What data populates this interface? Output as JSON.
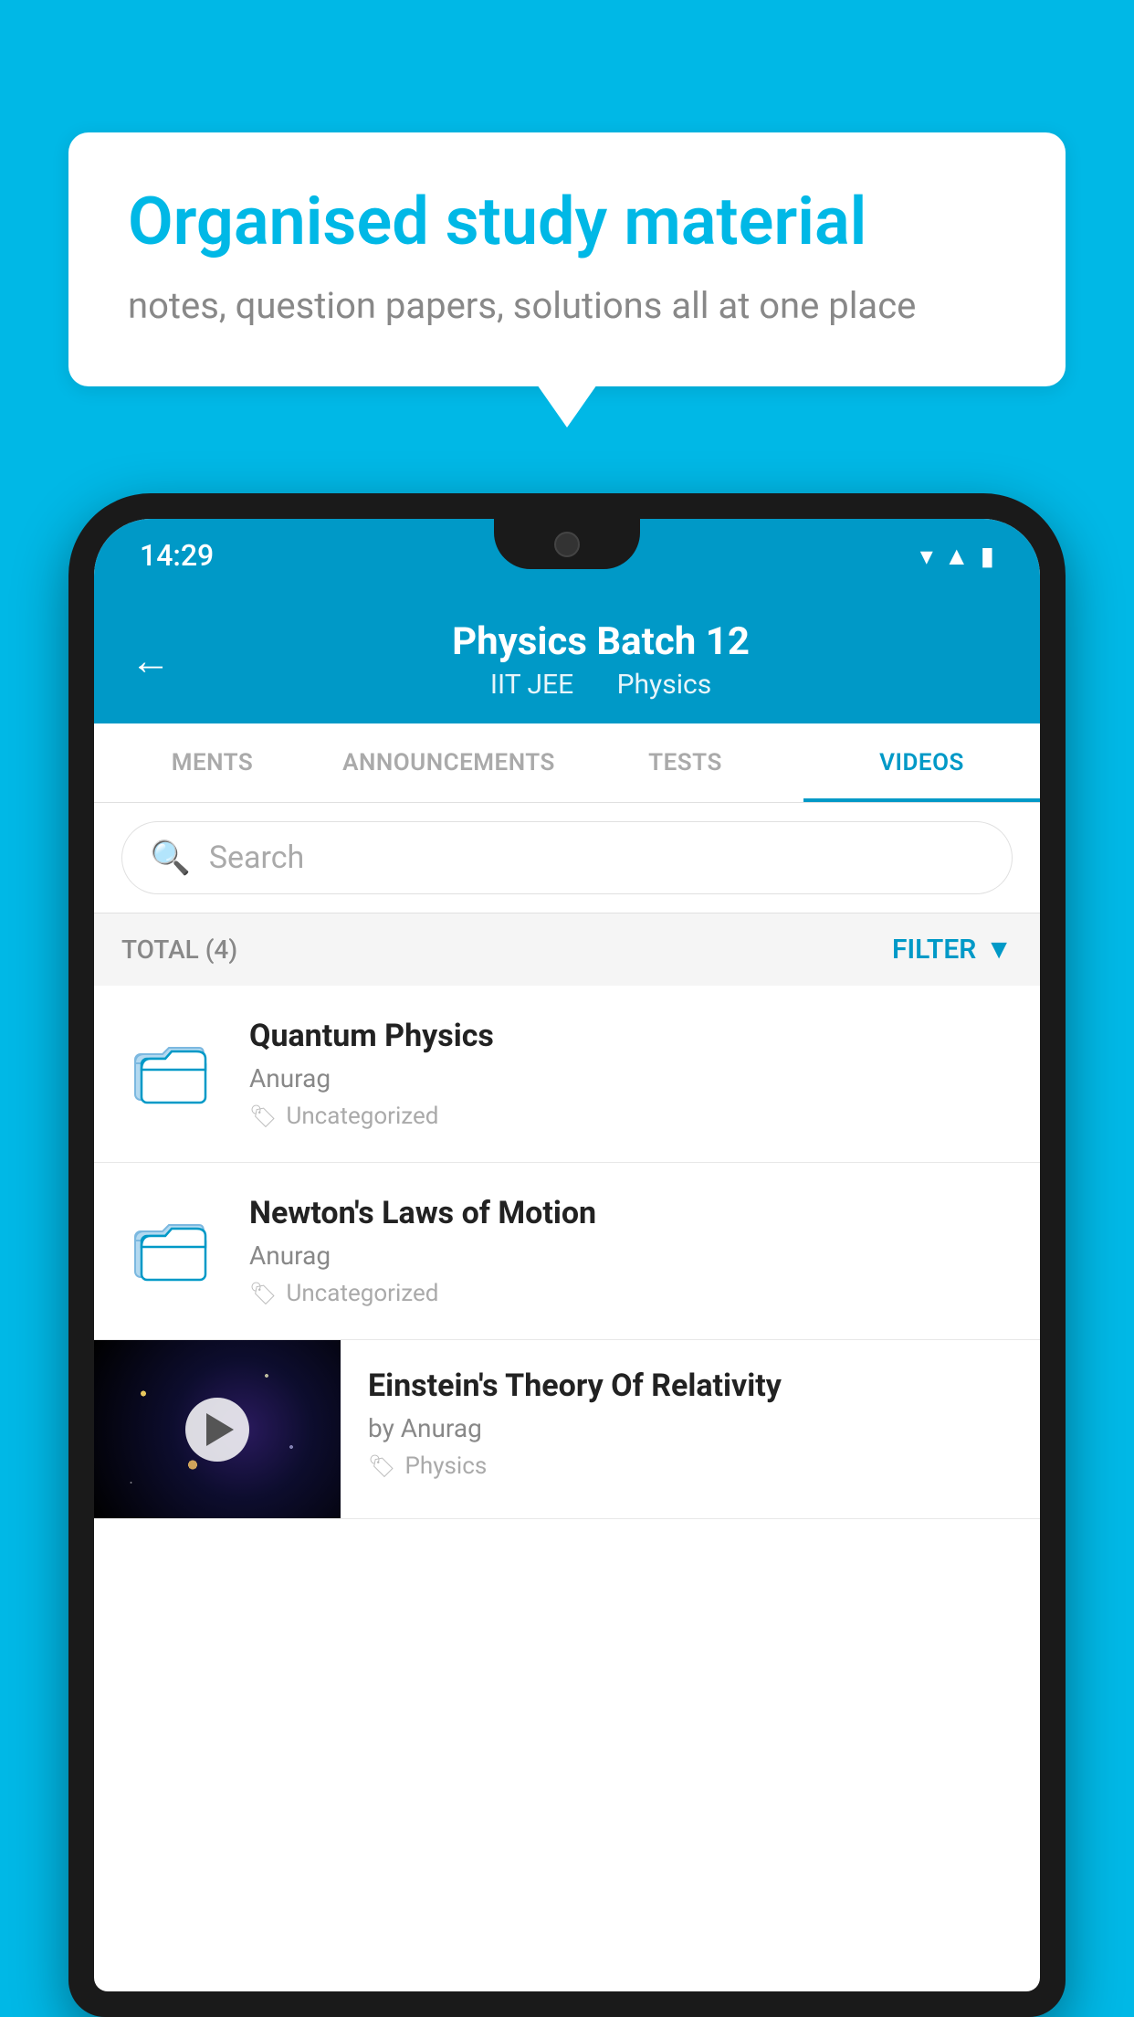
{
  "background_color": "#00b8e6",
  "speech_bubble": {
    "title": "Organised study material",
    "subtitle": "notes, question papers, solutions all at one place"
  },
  "phone": {
    "status_bar": {
      "time": "14:29"
    },
    "header": {
      "title": "Physics Batch 12",
      "subtitle_part1": "IIT JEE",
      "subtitle_part2": "Physics",
      "back_label": "←"
    },
    "tabs": [
      {
        "label": "MENTS",
        "active": false
      },
      {
        "label": "ANNOUNCEMENTS",
        "active": false
      },
      {
        "label": "TESTS",
        "active": false
      },
      {
        "label": "VIDEOS",
        "active": true
      }
    ],
    "search": {
      "placeholder": "Search"
    },
    "filter_bar": {
      "total_label": "TOTAL (4)",
      "filter_label": "FILTER"
    },
    "videos": [
      {
        "title": "Quantum Physics",
        "author": "Anurag",
        "tag": "Uncategorized",
        "has_thumbnail": false
      },
      {
        "title": "Newton's Laws of Motion",
        "author": "Anurag",
        "tag": "Uncategorized",
        "has_thumbnail": false
      },
      {
        "title": "Einstein's Theory Of Relativity",
        "author": "by Anurag",
        "tag": "Physics",
        "has_thumbnail": true
      }
    ]
  }
}
